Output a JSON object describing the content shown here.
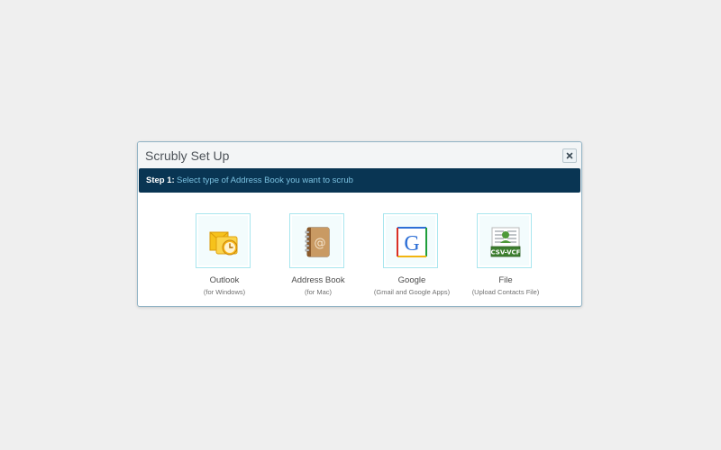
{
  "dialog": {
    "title": "Scrubly Set Up",
    "close_icon": "close-icon"
  },
  "step": {
    "label": "Step 1:",
    "text": "Select type of Address Book you want to scrub"
  },
  "options": [
    {
      "name": "Outlook",
      "sub": "(for Windows)",
      "icon": "outlook-icon"
    },
    {
      "name": "Address Book",
      "sub": "(for Mac)",
      "icon": "address-book-icon"
    },
    {
      "name": "Google",
      "sub": "(Gmail and Google Apps)",
      "icon": "google-icon"
    },
    {
      "name": "File",
      "sub": "(Upload Contacts File)",
      "icon": "file-icon",
      "badge": "CSV-VCF"
    }
  ],
  "colors": {
    "background": "#efefef",
    "step_bar": "#093553",
    "step_text": "#7bc1e0",
    "tile_border": "#a8e6ef"
  }
}
